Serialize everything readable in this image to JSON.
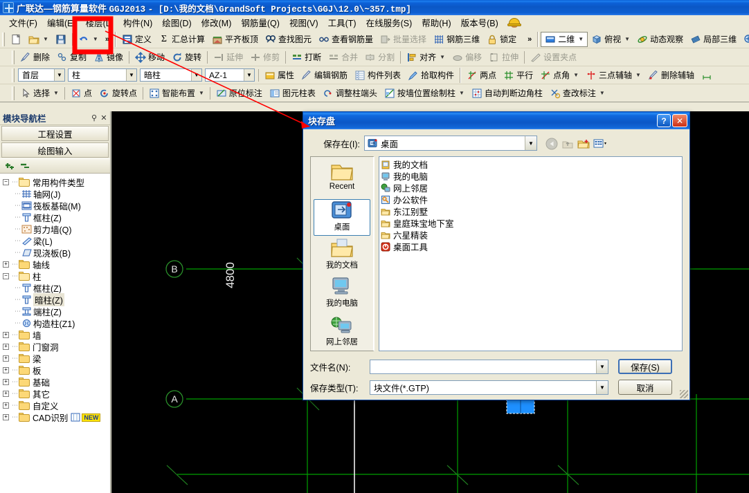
{
  "window": {
    "icon": "app-crosshair-icon",
    "title_app": "广联达—钢筋算量软件",
    "title_version": "GGJ2013",
    "title_path": "- [D:\\我的文档\\GrandSoft Projects\\GGJ\\12.0\\~357.tmp]"
  },
  "menubar": {
    "items": [
      {
        "label": "文件(F)",
        "name": "menu-file"
      },
      {
        "label": "编辑(E)",
        "name": "menu-edit"
      },
      {
        "label": "楼层(L)",
        "name": "menu-floor",
        "highlighted": true
      },
      {
        "label": "构件(N)",
        "name": "menu-component"
      },
      {
        "label": "绘图(D)",
        "name": "menu-draw"
      },
      {
        "label": "修改(M)",
        "name": "menu-modify"
      },
      {
        "label": "钢筋量(Q)",
        "name": "menu-rebar-qty"
      },
      {
        "label": "视图(V)",
        "name": "menu-view"
      },
      {
        "label": "工具(T)",
        "name": "menu-tools"
      },
      {
        "label": "在线服务(S)",
        "name": "menu-online-service"
      },
      {
        "label": "帮助(H)",
        "name": "menu-help"
      },
      {
        "label": "版本号(B)",
        "name": "menu-version"
      }
    ]
  },
  "toolbar_row1": {
    "left_icons": [
      "new-file-icon",
      "open-folder-icon",
      "save-disk-icon",
      "undo-icon"
    ],
    "overflow_label": "»",
    "items": [
      {
        "label": "定义",
        "icon": "define-icon",
        "disabled": false
      },
      {
        "label": "汇总计算",
        "icon": "sigma-icon",
        "disabled": false
      },
      {
        "label": "平齐板顶",
        "icon": "align-slab-top-icon",
        "disabled": false
      },
      {
        "label": "查找图元",
        "icon": "find-element-icon",
        "disabled": false
      },
      {
        "label": "查看钢筋量",
        "icon": "view-rebar-qty-icon",
        "disabled": false
      },
      {
        "label": "批量选择",
        "icon": "batch-select-icon",
        "disabled": true
      },
      {
        "label": "钢筋三维",
        "icon": "rebar-3d-icon",
        "disabled": false
      },
      {
        "label": "锁定",
        "icon": "lock-icon",
        "disabled": false
      }
    ],
    "overflow_right": "»",
    "view_items": [
      {
        "label": "二维",
        "icon": "view-2d-icon",
        "has_caret": true
      },
      {
        "label": "俯视",
        "icon": "top-view-icon",
        "has_caret": true
      },
      {
        "label": "动态观察",
        "icon": "orbit-icon",
        "has_caret": false
      },
      {
        "label": "局部三维",
        "icon": "local-3d-icon",
        "has_caret": false
      },
      {
        "label": "全屏",
        "icon": "fullscreen-icon",
        "has_caret": false
      }
    ]
  },
  "toolbar_row2": {
    "items": [
      {
        "label": "删除",
        "icon": "delete-icon",
        "disabled": false
      },
      {
        "label": "复制",
        "icon": "copy-icon",
        "disabled": false
      },
      {
        "label": "镜像",
        "icon": "mirror-icon",
        "disabled": false
      },
      {
        "label": "移动",
        "icon": "move-icon",
        "disabled": false
      },
      {
        "label": "旋转",
        "icon": "rotate-icon",
        "disabled": false
      },
      {
        "label": "延伸",
        "icon": "extend-icon",
        "disabled": true
      },
      {
        "label": "修剪",
        "icon": "trim-icon",
        "disabled": true
      },
      {
        "label": "打断",
        "icon": "break-icon",
        "disabled": false
      },
      {
        "label": "合并",
        "icon": "merge-icon",
        "disabled": true
      },
      {
        "label": "分割",
        "icon": "split-icon",
        "disabled": true
      },
      {
        "label": "对齐",
        "icon": "align-icon",
        "disabled": false,
        "has_caret": true
      },
      {
        "label": "偏移",
        "icon": "offset-icon",
        "disabled": true
      },
      {
        "label": "拉伸",
        "icon": "stretch-icon",
        "disabled": true
      },
      {
        "label": "设置夹点",
        "icon": "set-grip-icon",
        "disabled": true
      }
    ]
  },
  "toolbar_row3": {
    "combos": [
      {
        "name": "floor-select",
        "value": "首层"
      },
      {
        "name": "category-select",
        "value": "柱"
      },
      {
        "name": "type-select",
        "value": "暗柱"
      },
      {
        "name": "member-select",
        "value": "AZ-1"
      }
    ],
    "items": [
      {
        "label": "属性",
        "icon": "properties-icon"
      },
      {
        "label": "编辑钢筋",
        "icon": "edit-rebar-icon"
      },
      {
        "label": "构件列表",
        "icon": "component-list-icon"
      },
      {
        "label": "拾取构件",
        "icon": "pick-component-icon"
      },
      {
        "label": "两点",
        "icon": "two-point-icon"
      },
      {
        "label": "平行",
        "icon": "parallel-icon"
      },
      {
        "label": "点角",
        "icon": "point-angle-icon",
        "has_caret": true
      },
      {
        "label": "三点辅轴",
        "icon": "three-point-axis-icon",
        "has_caret": true
      },
      {
        "label": "删除辅轴",
        "icon": "delete-axis-icon"
      }
    ]
  },
  "toolbar_row4": {
    "items": [
      {
        "label": "选择",
        "icon": "select-arrow-icon",
        "has_caret": true
      },
      {
        "label": "点",
        "icon": "point-icon"
      },
      {
        "label": "旋转点",
        "icon": "rotate-point-icon"
      },
      {
        "label": "智能布置",
        "icon": "smart-layout-icon",
        "has_caret": true
      },
      {
        "label": "原位标注",
        "icon": "in-place-annotation-icon"
      },
      {
        "label": "图元柱表",
        "icon": "element-column-table-icon"
      },
      {
        "label": "调整柱端头",
        "icon": "adjust-column-end-icon"
      },
      {
        "label": "按墙位置绘制柱",
        "icon": "draw-column-by-wall-icon",
        "has_caret": true
      },
      {
        "label": "自动判断边角柱",
        "icon": "auto-corner-column-icon"
      },
      {
        "label": "查改标注",
        "icon": "check-edit-annotation-icon",
        "has_caret": true
      }
    ]
  },
  "sidebar": {
    "title": "模块导航栏",
    "pin_icon": "pin-icon",
    "close_icon": "close-icon",
    "buttons": [
      {
        "label": "工程设置",
        "name": "project-settings-button"
      },
      {
        "label": "绘图输入",
        "name": "drawing-input-button"
      }
    ],
    "tool_icons": [
      "expand-all-icon",
      "collapse-all-icon"
    ],
    "tree": [
      {
        "label": "常用构件类型",
        "level": 0,
        "type": "folder",
        "state": "expanded"
      },
      {
        "label": "轴网(J)",
        "level": 1,
        "type": "leaf",
        "icon": "axis-grid-icon"
      },
      {
        "label": "筏板基础(M)",
        "level": 1,
        "type": "leaf",
        "icon": "raft-foundation-icon"
      },
      {
        "label": "框柱(Z)",
        "level": 1,
        "type": "leaf",
        "icon": "frame-column-icon"
      },
      {
        "label": "剪力墙(Q)",
        "level": 1,
        "type": "leaf",
        "icon": "shear-wall-icon"
      },
      {
        "label": "梁(L)",
        "level": 1,
        "type": "leaf",
        "icon": "beam-icon"
      },
      {
        "label": "现浇板(B)",
        "level": 1,
        "type": "leaf",
        "icon": "cast-slab-icon"
      },
      {
        "label": "轴线",
        "level": 0,
        "type": "folder",
        "state": "collapsed"
      },
      {
        "label": "柱",
        "level": 0,
        "type": "folder",
        "state": "expanded"
      },
      {
        "label": "框柱(Z)",
        "level": 1,
        "type": "leaf",
        "icon": "frame-column-icon"
      },
      {
        "label": "暗柱(Z)",
        "level": 1,
        "type": "leaf",
        "icon": "hidden-column-icon",
        "selected": true
      },
      {
        "label": "端柱(Z)",
        "level": 1,
        "type": "leaf",
        "icon": "end-column-icon"
      },
      {
        "label": "构造柱(Z1)",
        "level": 1,
        "type": "leaf",
        "icon": "structural-column-icon"
      },
      {
        "label": "墙",
        "level": 0,
        "type": "folder",
        "state": "collapsed"
      },
      {
        "label": "门窗洞",
        "level": 0,
        "type": "folder",
        "state": "collapsed"
      },
      {
        "label": "梁",
        "level": 0,
        "type": "folder",
        "state": "collapsed"
      },
      {
        "label": "板",
        "level": 0,
        "type": "folder",
        "state": "collapsed"
      },
      {
        "label": "基础",
        "level": 0,
        "type": "folder",
        "state": "collapsed"
      },
      {
        "label": "其它",
        "level": 0,
        "type": "folder",
        "state": "collapsed"
      },
      {
        "label": "自定义",
        "level": 0,
        "type": "folder",
        "state": "collapsed"
      },
      {
        "label": "CAD识别",
        "level": 0,
        "type": "folder",
        "state": "collapsed",
        "badge": "NEW"
      }
    ]
  },
  "canvas": {
    "background": "#000000",
    "grid_color": "#00a000",
    "axis_labels": [
      "B",
      "A"
    ],
    "dimension_text": "4800",
    "selected_element_color": "#1e90ff"
  },
  "dialog": {
    "title": "块存盘",
    "help_button": "?",
    "close_button": "✕",
    "save_in_label": "保存在(I):",
    "save_in_value": "桌面",
    "save_in_icon": "desktop-icon",
    "nav_buttons": [
      "back-icon",
      "up-folder-icon",
      "new-folder-icon",
      "view-mode-icon"
    ],
    "places": [
      {
        "label": "Recent",
        "icon": "recent-folder-icon",
        "selected": false
      },
      {
        "label": "桌面",
        "icon": "desktop-icon",
        "selected": true
      },
      {
        "label": "我的文档",
        "icon": "my-documents-icon",
        "selected": false
      },
      {
        "label": "我的电脑",
        "icon": "my-computer-icon",
        "selected": false
      },
      {
        "label": "网上邻居",
        "icon": "network-places-icon",
        "selected": false
      }
    ],
    "files": [
      {
        "label": "我的文档",
        "icon": "my-documents-icon"
      },
      {
        "label": "我的电脑",
        "icon": "my-computer-icon"
      },
      {
        "label": "网上邻居",
        "icon": "network-places-icon"
      },
      {
        "label": "办公软件",
        "icon": "shortcut-key-icon"
      },
      {
        "label": "东江别墅",
        "icon": "folder-icon"
      },
      {
        "label": "皇庭珠宝地下室",
        "icon": "folder-icon"
      },
      {
        "label": "六星精装",
        "icon": "folder-icon"
      },
      {
        "label": "桌面工具",
        "icon": "app-red-icon"
      }
    ],
    "filename_label": "文件名(N):",
    "filename_value": "",
    "filetype_label": "保存类型(T):",
    "filetype_value": "块文件(*.GTP)",
    "save_button": "保存(S)",
    "cancel_button": "取消"
  },
  "annotation": {
    "color": "#ff0000",
    "highlight_target": "楼层(L) 菜单",
    "arrow_to": "块存盘 对话框标题栏"
  }
}
